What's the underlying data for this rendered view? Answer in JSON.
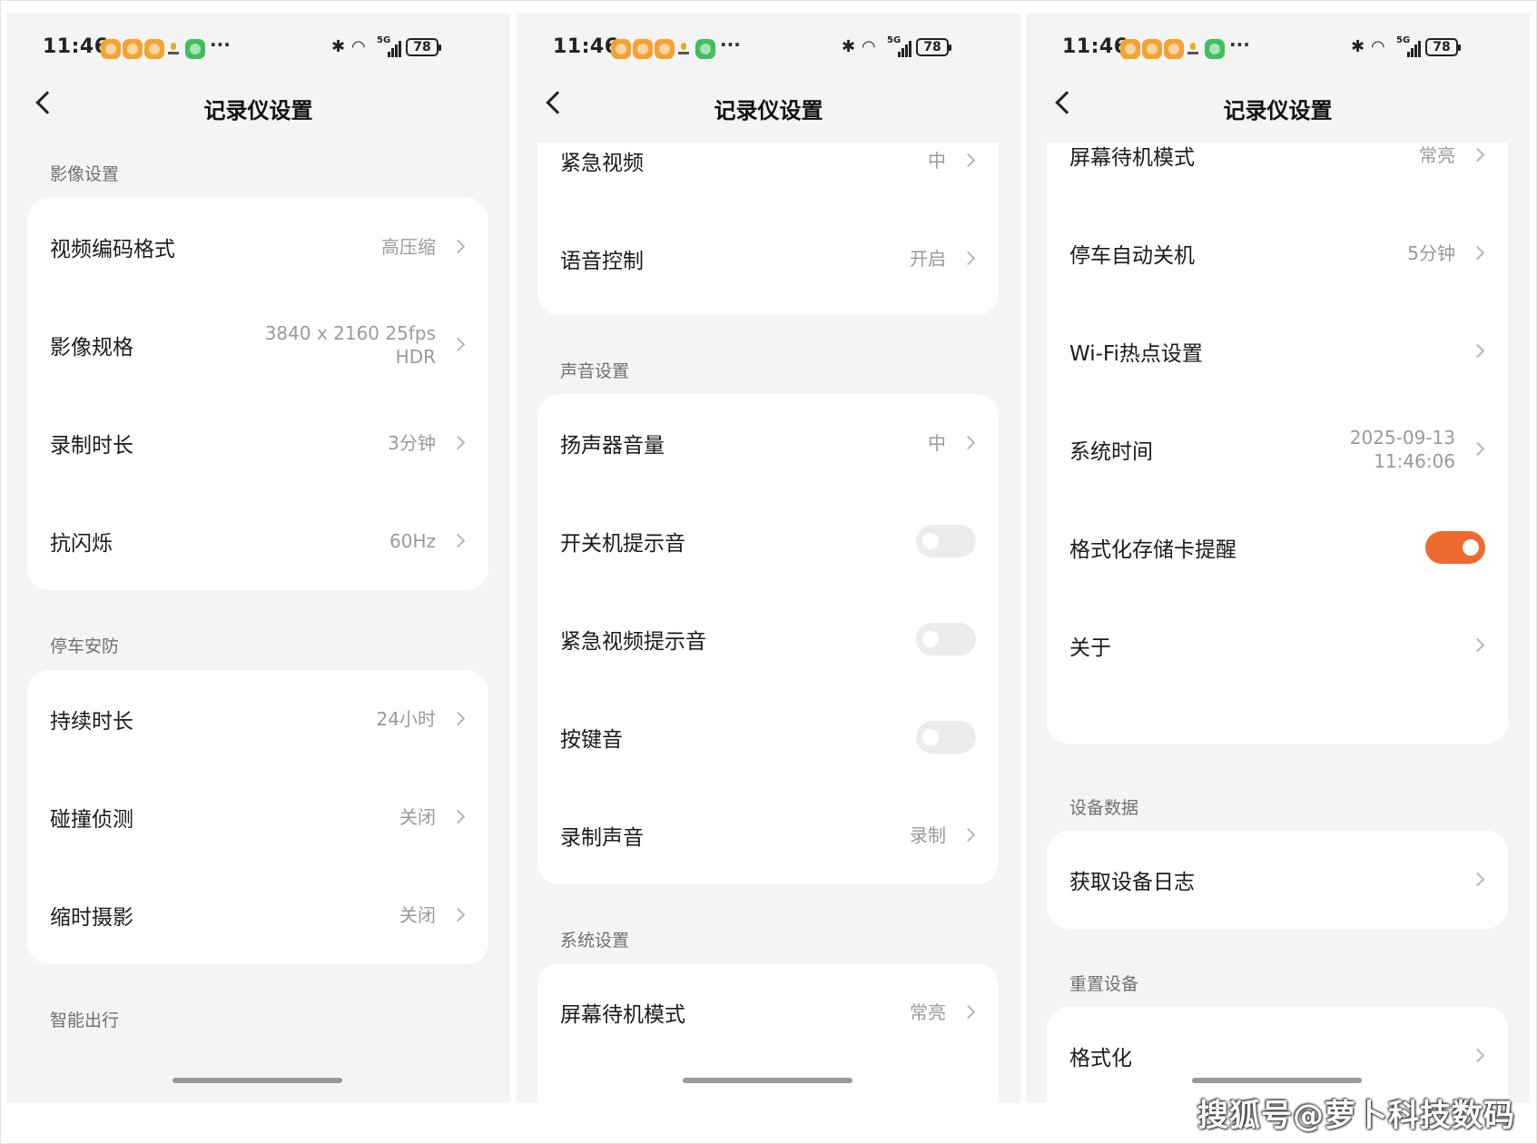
{
  "status_bar": {
    "time": "11:46",
    "network": "5G",
    "battery": "78"
  },
  "colors": {
    "accent": "#ee6a2f",
    "background": "#f4f4f4",
    "card": "#ffffff"
  },
  "panels": [
    {
      "title": "记录仪设置",
      "sections": [
        {
          "header": "影像设置",
          "rows": [
            {
              "label": "视频编码格式",
              "value": "高压缩"
            },
            {
              "label": "影像规格",
              "value": "3840 x 2160 25fps",
              "value2": "HDR"
            },
            {
              "label": "录制时长",
              "value": "3分钟"
            },
            {
              "label": "抗闪烁",
              "value": "60Hz"
            }
          ]
        },
        {
          "header": "停车安防",
          "rows": [
            {
              "label": "持续时长",
              "value": "24小时"
            },
            {
              "label": "碰撞侦测",
              "value": "关闭"
            },
            {
              "label": "缩时摄影",
              "value": "关闭"
            }
          ]
        },
        {
          "header": "智能出行"
        }
      ]
    },
    {
      "title": "记录仪设置",
      "sections": [
        {
          "rows": [
            {
              "label": "紧急视频",
              "value": "中"
            },
            {
              "label": "语音控制",
              "value": "开启"
            }
          ]
        },
        {
          "header": "声音设置",
          "rows": [
            {
              "label": "扬声器音量",
              "value": "中"
            },
            {
              "label": "开关机提示音",
              "toggle": false
            },
            {
              "label": "紧急视频提示音",
              "toggle": false
            },
            {
              "label": "按键音",
              "toggle": false
            },
            {
              "label": "录制声音",
              "value": "录制"
            }
          ]
        },
        {
          "header": "系统设置",
          "rows": [
            {
              "label": "屏幕待机模式",
              "value": "常亮"
            }
          ]
        }
      ]
    },
    {
      "title": "记录仪设置",
      "sections": [
        {
          "rows": [
            {
              "label": "屏幕待机模式",
              "value": "常亮"
            },
            {
              "label": "停车自动关机",
              "value": "5分钟"
            },
            {
              "label": "Wi-Fi热点设置",
              "value": ""
            },
            {
              "label": "系统时间",
              "value": "2025-09-13",
              "value2": "11:46:06"
            },
            {
              "label": "格式化存储卡提醒",
              "toggle": true
            },
            {
              "label": "关于",
              "value": ""
            }
          ]
        },
        {
          "header": "设备数据",
          "rows": [
            {
              "label": "获取设备日志",
              "value": ""
            }
          ]
        },
        {
          "header": "重置设备",
          "rows": [
            {
              "label": "格式化",
              "value": ""
            }
          ]
        }
      ]
    }
  ],
  "watermark": "搜狐号@萝卜科技数码"
}
